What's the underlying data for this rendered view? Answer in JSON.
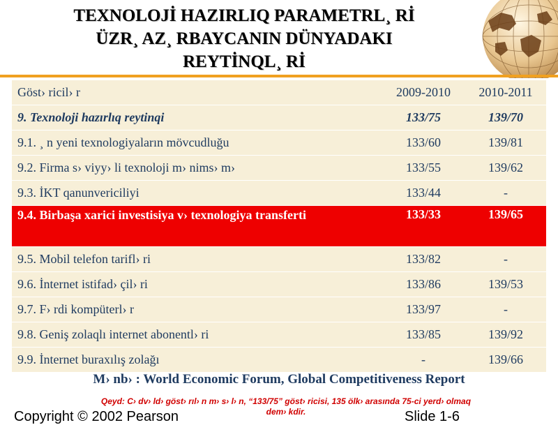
{
  "title": {
    "line1": "TEXNOLOJİ HAZIRLIQ PARAMETRL¸ Rİ",
    "line2": "ÜZR¸ AZ¸ RBAYCANIN DÜNYADAKI",
    "line3": "REYTİNQL¸ Rİ"
  },
  "colors": {
    "accent_line": "#f0a020",
    "highlight_row": "#ee0000",
    "table_text": "#1f3b60",
    "table_bg": "#f7efd8",
    "note_text": "#d00000"
  },
  "table": {
    "header": [
      "Göst› ricil› r",
      "2009-2010",
      "2010-2011"
    ],
    "rows": [
      {
        "label": "9. Texnoloji hazırlıq reytinqi",
        "y2009": "133/75",
        "y2010": "139/70"
      },
      {
        "label": "9.1. ¸ n yeni texnologiyaların mövcudluğu",
        "y2009": "133/60",
        "y2010": "139/81"
      },
      {
        "label": "9.2. Firma s› viyy› li texnoloji m› nims› m›",
        "y2009": "133/55",
        "y2010": "139/62"
      },
      {
        "label": "9.3. İKT qanunvericiliyi",
        "y2009": "133/44",
        "y2010": "-"
      },
      {
        "label": "9.4. Birbaşa xarici investisiya v› texnologiya transferti",
        "y2009": "133/33",
        "y2010": "139/65"
      },
      {
        "label": "9.5. Mobil telefon tarifl› ri",
        "y2009": "133/82",
        "y2010": "-"
      },
      {
        "label": "9.6. İnternet istifad› çil› ri",
        "y2009": "133/86",
        "y2010": "139/53"
      },
      {
        "label": "9.7. F› rdi kompüterl› r",
        "y2009": "133/97",
        "y2010": "-"
      },
      {
        "label": "9.8. Geniş zolaqlı internet abonentl› ri",
        "y2009": "133/85",
        "y2010": "139/92"
      },
      {
        "label": "9.9. İnternet buraxılış zolağı",
        "y2009": "-",
        "y2010": "139/66"
      }
    ]
  },
  "source": "M› nb› : World Economic Forum, Global Competitiveness Report",
  "note": {
    "line1": "Qeyd: C› dv› ld› göst› rıl› n m› s› l› n, “133/75” göst› ricisi, 135 ölk› arasında 75-ci yerd› olmaq",
    "line2": "dem› kdir."
  },
  "footer": {
    "left": "Copyright © 2002 Pearson",
    "right": "Slide 1-6"
  },
  "icons": {
    "globe": "globe-icon"
  }
}
